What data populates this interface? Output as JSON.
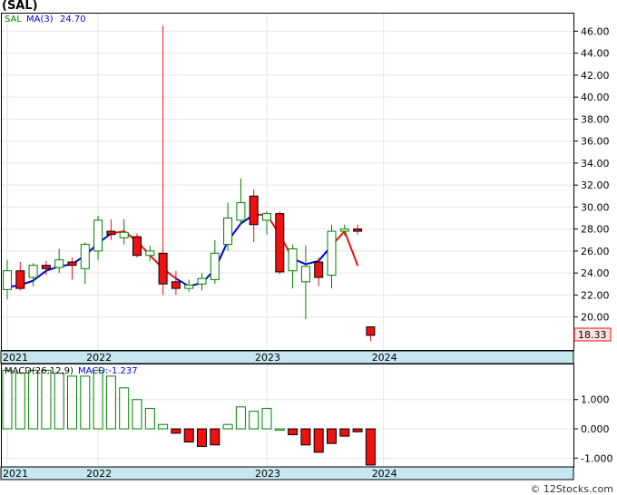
{
  "header": {
    "title": "(SAL)"
  },
  "footer": {
    "text": "© 12Stocks.com"
  },
  "colors": {
    "up": "#008000",
    "down": "#ee1111",
    "ma_up": "#0000dd",
    "ma_down": "#ee1111",
    "axis_band": "#c8e6f0",
    "price_box": "#ffe0e0"
  },
  "chart_data": [
    {
      "type": "candlestick",
      "title": "(SAL)",
      "legend": {
        "symbol": "SAL",
        "ma_label": "MA(3)",
        "ma_value": "24.70"
      },
      "last_price": "18.33",
      "ylim": [
        17.0,
        47.6
      ],
      "y_ticks": [
        20.0,
        22.0,
        24.0,
        26.0,
        28.0,
        30.0,
        32.0,
        34.0,
        36.0,
        38.0,
        40.0,
        42.0,
        44.0,
        46.0
      ],
      "x_tick_labels": [
        {
          "label": "2021",
          "index": 0
        },
        {
          "label": "2022",
          "index": 7
        },
        {
          "label": "2023",
          "index": 20
        },
        {
          "label": "2024",
          "index": 29
        }
      ],
      "candles": [
        {
          "o": 22.5,
          "h": 25.2,
          "l": 21.6,
          "c": 24.2
        },
        {
          "o": 24.2,
          "h": 25.0,
          "l": 22.4,
          "c": 22.6
        },
        {
          "o": 23.6,
          "h": 24.9,
          "l": 22.8,
          "c": 24.7
        },
        {
          "o": 24.7,
          "h": 25.1,
          "l": 23.8,
          "c": 24.4
        },
        {
          "o": 24.5,
          "h": 26.2,
          "l": 24.0,
          "c": 25.2
        },
        {
          "o": 25.0,
          "h": 25.4,
          "l": 23.4,
          "c": 24.7
        },
        {
          "o": 24.4,
          "h": 26.8,
          "l": 23.0,
          "c": 26.6
        },
        {
          "o": 26.0,
          "h": 29.2,
          "l": 25.2,
          "c": 28.8
        },
        {
          "o": 27.8,
          "h": 28.9,
          "l": 27.0,
          "c": 27.5
        },
        {
          "o": 27.2,
          "h": 28.9,
          "l": 26.6,
          "c": 27.7
        },
        {
          "o": 27.3,
          "h": 27.6,
          "l": 25.4,
          "c": 25.6
        },
        {
          "o": 25.6,
          "h": 26.5,
          "l": 25.1,
          "c": 26.0
        },
        {
          "o": 25.8,
          "h": 46.5,
          "l": 22.0,
          "c": 23.0
        },
        {
          "o": 23.2,
          "h": 24.2,
          "l": 22.0,
          "c": 22.6
        },
        {
          "o": 22.6,
          "h": 23.4,
          "l": 22.3,
          "c": 22.9
        },
        {
          "o": 23.0,
          "h": 24.0,
          "l": 22.4,
          "c": 23.5
        },
        {
          "o": 23.4,
          "h": 27.0,
          "l": 23.0,
          "c": 25.8
        },
        {
          "o": 26.6,
          "h": 30.4,
          "l": 26.0,
          "c": 29.0
        },
        {
          "o": 28.8,
          "h": 32.6,
          "l": 28.4,
          "c": 30.4
        },
        {
          "o": 31.0,
          "h": 31.6,
          "l": 26.8,
          "c": 28.4
        },
        {
          "o": 28.8,
          "h": 29.6,
          "l": 27.5,
          "c": 29.4
        },
        {
          "o": 29.4,
          "h": 29.6,
          "l": 23.9,
          "c": 24.1
        },
        {
          "o": 24.2,
          "h": 26.6,
          "l": 22.6,
          "c": 26.2
        },
        {
          "o": 23.2,
          "h": 26.5,
          "l": 19.8,
          "c": 24.6
        },
        {
          "o": 25.0,
          "h": 25.4,
          "l": 22.8,
          "c": 23.6
        },
        {
          "o": 23.8,
          "h": 28.4,
          "l": 22.6,
          "c": 27.8
        },
        {
          "o": 27.8,
          "h": 28.4,
          "l": 27.4,
          "c": 28.0
        },
        {
          "o": 28.0,
          "h": 28.4,
          "l": 27.5,
          "c": 27.8
        },
        {
          "o": 19.1,
          "h": 19.1,
          "l": 17.8,
          "c": 18.33
        }
      ],
      "ma": [
        {
          "index": 0,
          "v": 22.7,
          "dir": "up"
        },
        {
          "index": 1,
          "v": 22.9,
          "dir": "up"
        },
        {
          "index": 2,
          "v": 23.3,
          "dir": "up"
        },
        {
          "index": 3,
          "v": 24.2,
          "dir": "up"
        },
        {
          "index": 4,
          "v": 24.6,
          "dir": "up"
        },
        {
          "index": 5,
          "v": 24.8,
          "dir": "up"
        },
        {
          "index": 6,
          "v": 25.6,
          "dir": "up"
        },
        {
          "index": 7,
          "v": 26.7,
          "dir": "up"
        },
        {
          "index": 8,
          "v": 27.6,
          "dir": "up"
        },
        {
          "index": 9,
          "v": 27.8,
          "dir": "down"
        },
        {
          "index": 10,
          "v": 26.9,
          "dir": "down"
        },
        {
          "index": 11,
          "v": 25.6,
          "dir": "down"
        },
        {
          "index": 12,
          "v": 24.4,
          "dir": "down"
        },
        {
          "index": 13,
          "v": 23.5,
          "dir": "down"
        },
        {
          "index": 14,
          "v": 22.8,
          "dir": "up"
        },
        {
          "index": 15,
          "v": 23.1,
          "dir": "up"
        },
        {
          "index": 16,
          "v": 24.3,
          "dir": "up"
        },
        {
          "index": 17,
          "v": 26.9,
          "dir": "up"
        },
        {
          "index": 18,
          "v": 28.5,
          "dir": "up"
        },
        {
          "index": 19,
          "v": 29.3,
          "dir": "up"
        },
        {
          "index": 20,
          "v": 29.3,
          "dir": "down"
        },
        {
          "index": 21,
          "v": 27.5,
          "dir": "down"
        },
        {
          "index": 22,
          "v": 25.3,
          "dir": "down"
        },
        {
          "index": 23,
          "v": 24.8,
          "dir": "up"
        },
        {
          "index": 24,
          "v": 25.1,
          "dir": "up"
        },
        {
          "index": 25,
          "v": 26.5,
          "dir": "up"
        },
        {
          "index": 26,
          "v": 27.8,
          "dir": "down"
        },
        {
          "index": 27,
          "v": 24.7,
          "dir": "down"
        }
      ]
    },
    {
      "type": "bar",
      "legend": {
        "label": "MACD(26,12,9)",
        "value_label": "MACD:-1.237"
      },
      "ylim": [
        -1.3,
        2.2
      ],
      "y_ticks": [
        -1.0,
        0.0,
        1.0
      ],
      "y_tick_labels": [
        "-1.000",
        "0.000",
        "1.000"
      ],
      "x_tick_labels": [
        {
          "label": "2021",
          "index": 0
        },
        {
          "label": "2022",
          "index": 7
        },
        {
          "label": "2023",
          "index": 20
        },
        {
          "label": "2024",
          "index": 29
        }
      ],
      "values": [
        2.0,
        1.9,
        2.0,
        2.0,
        1.9,
        1.8,
        1.8,
        2.0,
        1.8,
        1.4,
        1.0,
        0.7,
        0.15,
        -0.15,
        -0.45,
        -0.6,
        -0.55,
        0.15,
        0.75,
        0.6,
        0.7,
        0.0,
        -0.2,
        -0.55,
        -0.8,
        -0.5,
        -0.25,
        -0.1,
        -1.237
      ]
    }
  ]
}
